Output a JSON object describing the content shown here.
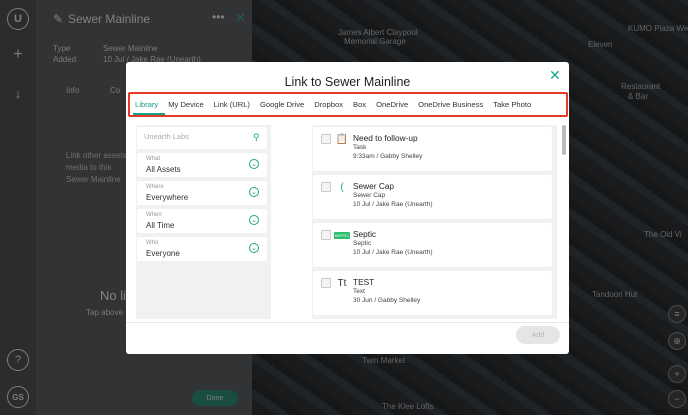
{
  "map": {
    "labels": [
      "James Albert Claypool",
      "Memorial Garage",
      "KUMO Plaza West",
      "Eleven",
      "Restaurant",
      "& Bar",
      "The Old Vi",
      "Tandoori Hut",
      "Twin Market",
      "The Klee Lofts"
    ]
  },
  "rail": {
    "logo": "U",
    "add": "+",
    "download": "↓",
    "help": "?",
    "initials": "GS"
  },
  "panel": {
    "title": "Sewer Mainline",
    "type_label": "Type",
    "type_value": "Sewer Mainline",
    "added_label": "Added",
    "added_value": "10 Jul / Jake Rae (Unearth)",
    "tab_info": "Info",
    "tab_co": "Co",
    "body": "Link other assets or media to this Sewer Mainline",
    "empty_title": "No li",
    "empty_hint": "Tap above",
    "done": "Done"
  },
  "modal": {
    "title": "Link to Sewer Mainline",
    "tabs": [
      "Library",
      "My Device",
      "Link (URL)",
      "Google Drive",
      "Dropbox",
      "Box",
      "OneDrive",
      "OneDrive Business",
      "Take Photo"
    ],
    "active_tab": "Library",
    "search_placeholder": "Unearth Labs",
    "filters": [
      {
        "label": "What",
        "value": "All Assets"
      },
      {
        "label": "Where",
        "value": "Everywhere"
      },
      {
        "label": "When",
        "value": "All Time"
      },
      {
        "label": "Who",
        "value": "Everyone"
      }
    ],
    "items": [
      {
        "name": "Need to follow-up",
        "type": "Task",
        "meta": "9:33am / Gabby Shelley",
        "icon": "clipboard-icon"
      },
      {
        "name": "Sewer Cap",
        "type": "Sewer Cap",
        "meta": "10 Jul / Jake Rae (Unearth)",
        "icon": "sewer-cap-icon"
      },
      {
        "name": "Septic",
        "type": "Septic",
        "meta": "10 Jul / Jake Rae (Unearth)",
        "icon": "septic-icon",
        "badge": "SEPTIC"
      },
      {
        "name": "TEST",
        "type": "Text",
        "meta": "30 Jun / Gabby Shelley",
        "icon": "text-icon",
        "icon_glyph": "Tt"
      }
    ],
    "add_label": "Add"
  },
  "colors": {
    "accent": "#16a085",
    "highlight": "#e53a2a"
  }
}
